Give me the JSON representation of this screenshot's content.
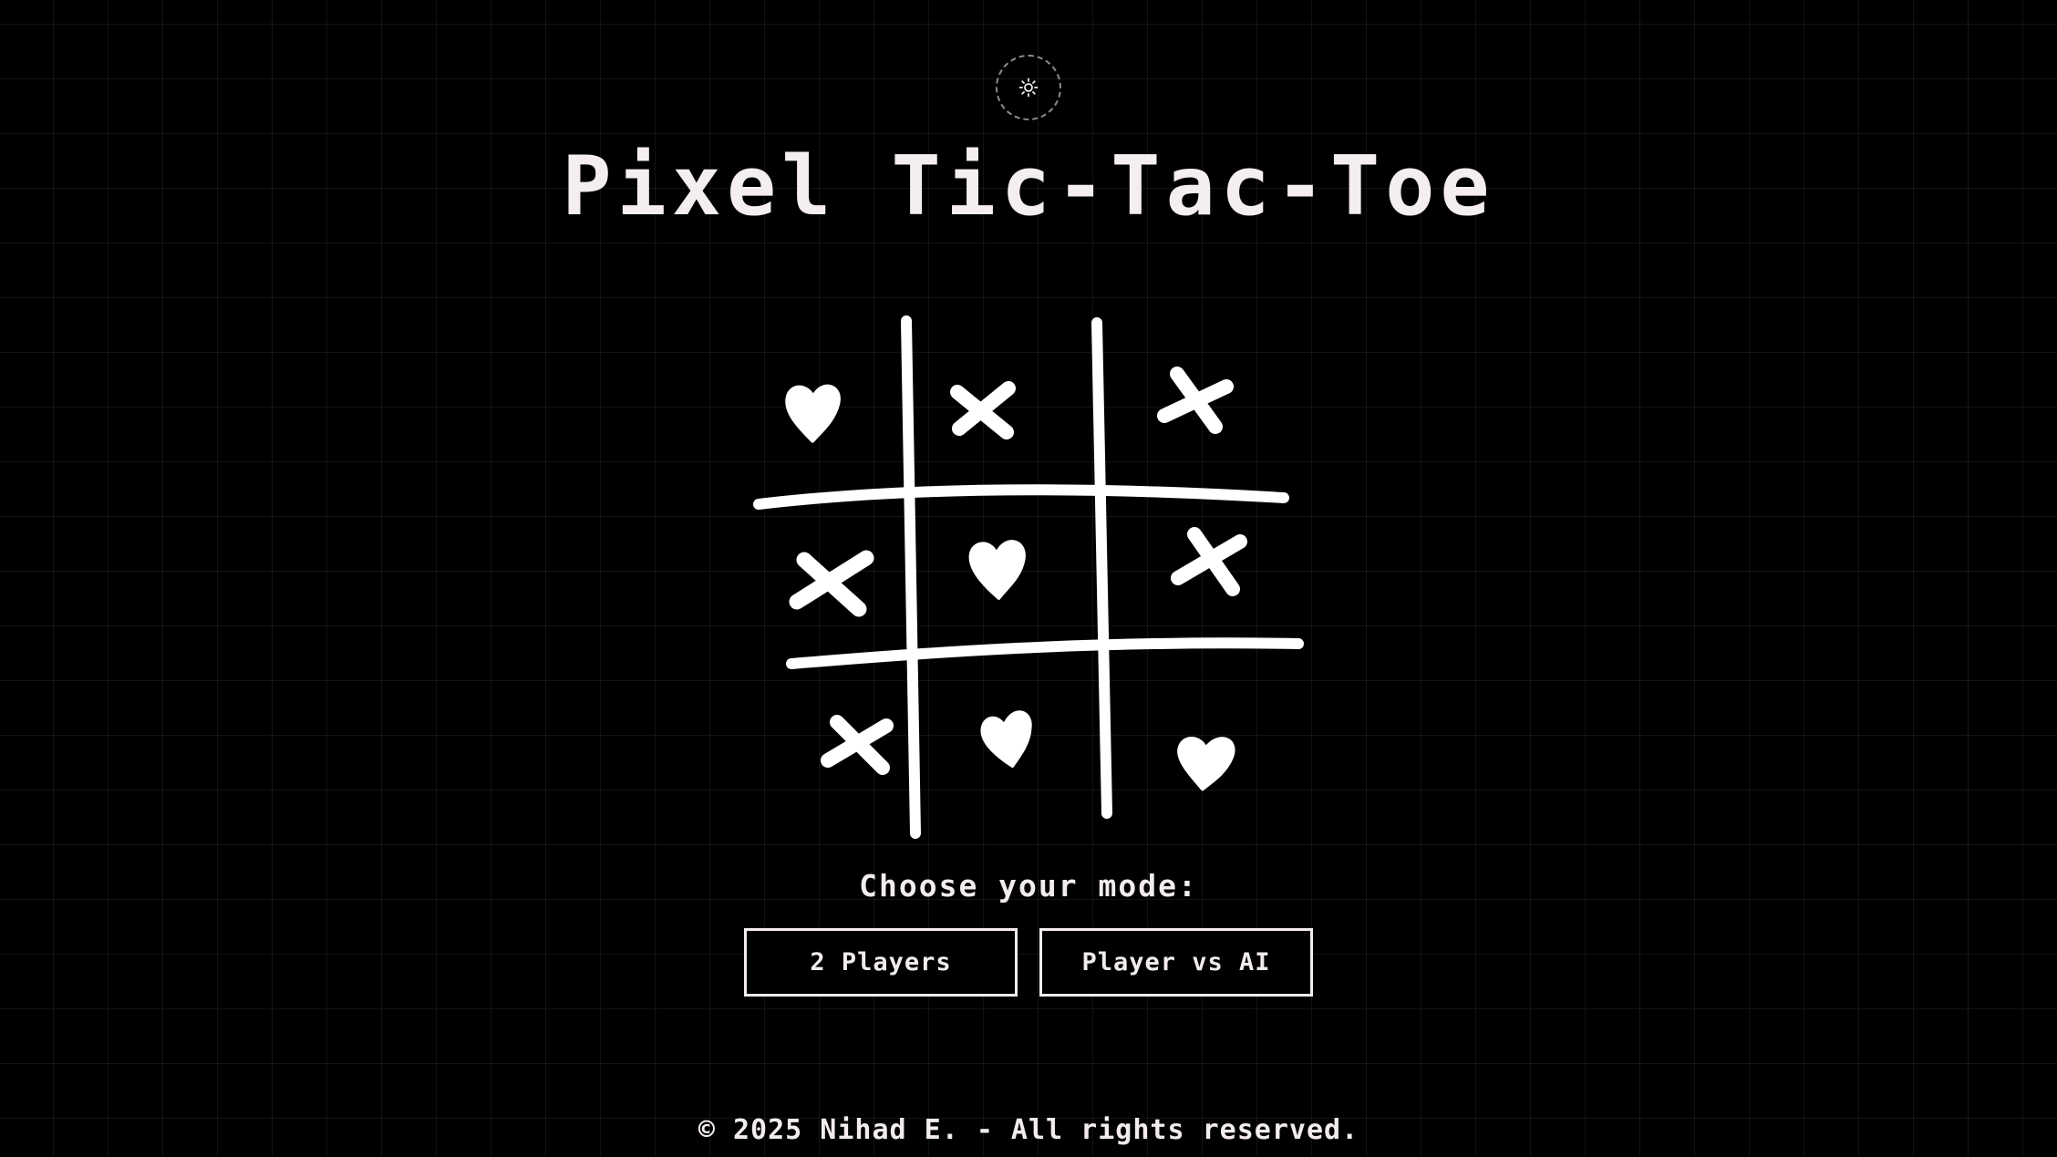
{
  "header": {
    "theme_toggle_icon": "sun-icon",
    "title": "Pixel Tic-Tac-Toe"
  },
  "board_illustration": {
    "cells": [
      "heart",
      "x",
      "x",
      "x",
      "heart",
      "x",
      "x",
      "heart",
      "heart"
    ],
    "icon_names": {
      "heart": "heart-icon",
      "x": "x-mark-icon"
    }
  },
  "mode_select": {
    "prompt": "Choose your mode:",
    "options": [
      {
        "label": "2 Players"
      },
      {
        "label": "Player vs AI"
      }
    ]
  },
  "footer": {
    "copyright": "© 2025 Nihad E. - All rights reserved."
  },
  "colors": {
    "background": "#000000",
    "foreground": "#f2ecec",
    "grid": "rgba(255,255,255,0.075)"
  }
}
